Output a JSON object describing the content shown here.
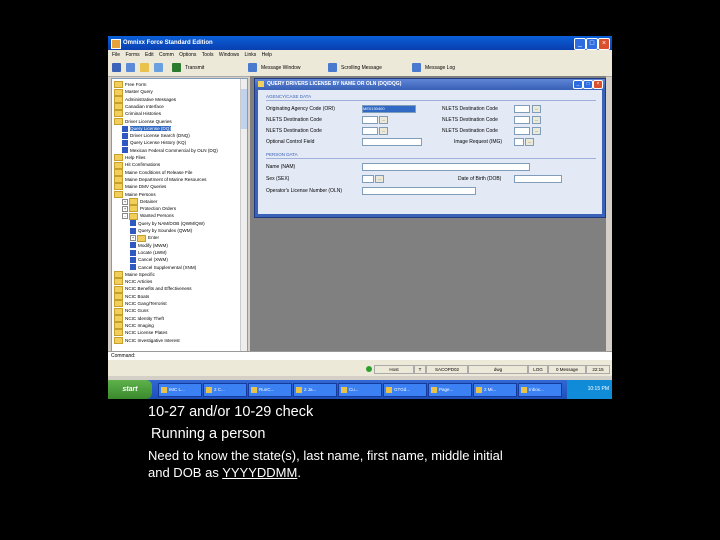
{
  "window": {
    "title": "Omnixx Force Standard Edition",
    "controls": [
      "_",
      "□",
      "×"
    ]
  },
  "menu": [
    "File",
    "Forms",
    "Edit",
    "Comm",
    "Options",
    "Tools",
    "Windows",
    "Links",
    "Help"
  ],
  "toolbar": {
    "transmit": "Transmit",
    "message_window": "Message Window",
    "scrolling_message": "Scrolling Message",
    "message_log": "Message Log"
  },
  "tree": [
    {
      "label": "Free Form",
      "icon": "folder-icon",
      "level": 0
    },
    {
      "label": "Master Query",
      "icon": "folder-icon",
      "level": 0
    },
    {
      "label": "Administrative Messages",
      "icon": "folder-icon",
      "level": 0
    },
    {
      "label": "Canadian Interface",
      "icon": "folder-icon",
      "level": 0
    },
    {
      "label": "Criminal Histories",
      "icon": "folder-icon",
      "level": 0
    },
    {
      "label": "Driver License Queries",
      "icon": "folder-icon",
      "level": 0
    },
    {
      "label": "Query License (DQ)",
      "icon": "form-icon",
      "level": 1,
      "selected": true
    },
    {
      "label": "Driver License Search (DNQ)",
      "icon": "form-icon",
      "level": 1
    },
    {
      "label": "Query License History (KQ)",
      "icon": "form-icon",
      "level": 1
    },
    {
      "label": "Mexican Federal Commercial by OLN (DQ)",
      "icon": "form-icon",
      "level": 1
    },
    {
      "label": "Help Files",
      "icon": "folder-icon",
      "level": 0
    },
    {
      "label": "Hit Confirmations",
      "icon": "folder-icon",
      "level": 0
    },
    {
      "label": "Maine Conditions of Release File",
      "icon": "folder-icon",
      "level": 0
    },
    {
      "label": "Maine Department of Marine Resources",
      "icon": "folder-icon",
      "level": 0
    },
    {
      "label": "Maine DMV Queries",
      "icon": "folder-icon",
      "level": 0
    },
    {
      "label": "Maine Persons",
      "icon": "folder-icon",
      "level": 0
    },
    {
      "label": "Detainer",
      "icon": "folder-icon",
      "level": 1,
      "expander": "+"
    },
    {
      "label": "Protection Orders",
      "icon": "folder-icon",
      "level": 1,
      "expander": "+"
    },
    {
      "label": "Wanted Persons",
      "icon": "folder-icon",
      "level": 1,
      "expander": "-"
    },
    {
      "label": "Query by NAM/DOB (QWM/QW)",
      "icon": "form-icon",
      "level": 2
    },
    {
      "label": "Query by Soundex (QWM)",
      "icon": "form-icon",
      "level": 2
    },
    {
      "label": "Enter",
      "icon": "folder-icon",
      "level": 2,
      "expander": "+"
    },
    {
      "label": "Modify (MWM)",
      "icon": "form-icon",
      "level": 2
    },
    {
      "label": "Locate (LWM)",
      "icon": "form-icon",
      "level": 2
    },
    {
      "label": "Cancel (XWM)",
      "icon": "form-icon",
      "level": 2
    },
    {
      "label": "Cancel Supplemental (XNM)",
      "icon": "form-icon",
      "level": 2
    },
    {
      "label": "Maine Specific",
      "icon": "folder-icon",
      "level": 0
    },
    {
      "label": "NCIC Articles",
      "icon": "folder-icon",
      "level": 0
    },
    {
      "label": "NCIC Benefits and Effectiveness",
      "icon": "folder-icon",
      "level": 0
    },
    {
      "label": "NCIC Boats",
      "icon": "folder-icon",
      "level": 0
    },
    {
      "label": "NCIC Gang/Terrorist",
      "icon": "folder-icon",
      "level": 0
    },
    {
      "label": "NCIC Guns",
      "icon": "folder-icon",
      "level": 0
    },
    {
      "label": "NCIC Identity Theft",
      "icon": "folder-icon",
      "level": 0
    },
    {
      "label": "NCIC Imaging",
      "icon": "folder-icon",
      "level": 0
    },
    {
      "label": "NCIC License Plates",
      "icon": "folder-icon",
      "level": 0
    },
    {
      "label": "NCIC Investigative Interest",
      "icon": "folder-icon",
      "level": 0
    }
  ],
  "dialog": {
    "title": "QUERY DRIVERS LICENSE BY NAME OR OLN (DQ/DQG)",
    "agency_section": "AGENCY/CASE DATA",
    "person_section": "PERSON DATA",
    "fields": {
      "ori": "Originating Agency Code (ORI)",
      "nlets1": "NLETS Destination Code",
      "nlets2": "NLETS Destination Code",
      "ocf": "Optional Control Field",
      "nlets_r1": "NLETS Destination Code",
      "nlets_r2": "NLETS Destination Code",
      "nlets_r3": "NLETS Destination Code",
      "img": "Image Request (IMG)",
      "name": "Name (NAM)",
      "sex": "Sex (SEX)",
      "dob": "Date of Birth (DOB)",
      "oln": "Operator's License Number (OLN)"
    },
    "ori_value": "ME0130400"
  },
  "command_label": "Command:",
  "status": {
    "host": "Host",
    "t": "T",
    "station": "SACOPD02",
    "user": "dwg",
    "log": "LOG",
    "messages": "0 Message",
    "time": "22:15"
  },
  "taskbar": {
    "start": "start",
    "tasks": [
      "IMC L...",
      "2 C...",
      "RunC...",
      "2 Ja...",
      "Cu...",
      "GTGd...",
      "Page...",
      "2 Mi...",
      "Inbox..."
    ],
    "clock": "10:15 PM"
  },
  "caption": {
    "line1": "10-27 and/or 10-29 check",
    "line2": "Running a person",
    "line3": "Need to know the state(s), last name, first name, middle initial",
    "line4_prefix": "and DOB as ",
    "line4_format": "YYYYDDMM",
    "line4_suffix": "."
  },
  "colors": {
    "titlebar": "#0a5fd8",
    "dialog": "#3a62b8",
    "background": "#000000",
    "caption_text": "#ffffff"
  }
}
